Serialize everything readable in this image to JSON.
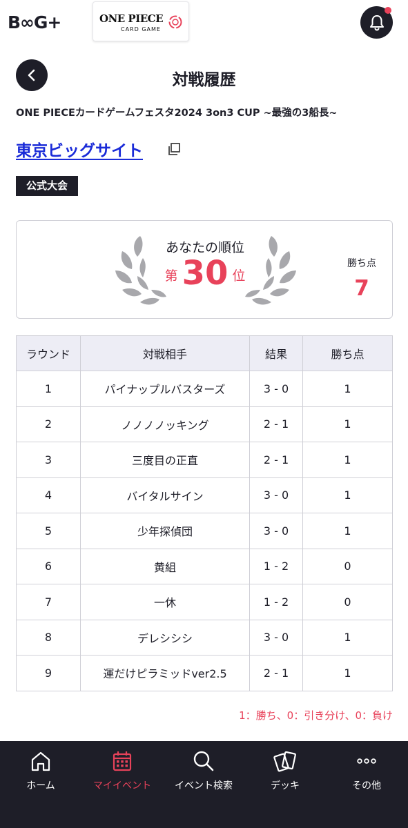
{
  "header": {
    "brand_logo": "B∞G+",
    "game_logo_title": "ONE PIECE",
    "game_logo_subtitle": "CARD GAME",
    "notification_icon": "bell-icon",
    "has_unread": true
  },
  "page": {
    "back_icon": "chevron-left-icon",
    "title": "対戦履歴",
    "event_name": "ONE PIECEカードゲームフェスタ2024 3on3 CUP ~最強の3船長~",
    "venue": "東京ビッグサイト",
    "venue_link_icon": "external-link-icon",
    "badge": "公式大会"
  },
  "rank": {
    "label": "あなたの順位",
    "prefix": "第",
    "number": "30",
    "suffix": "位",
    "points_label": "勝ち点",
    "points_value": "7"
  },
  "table": {
    "headers": [
      "ラウンド",
      "対戦相手",
      "結果",
      "勝ち点"
    ],
    "rows": [
      {
        "round": "1",
        "opponent": "パイナップルバスターズ",
        "result": "3 - 0",
        "points": "1"
      },
      {
        "round": "2",
        "opponent": "ノノノノッキング",
        "result": "2 - 1",
        "points": "1"
      },
      {
        "round": "3",
        "opponent": "三度目の正直",
        "result": "2 - 1",
        "points": "1"
      },
      {
        "round": "4",
        "opponent": "バイタルサイン",
        "result": "3 - 0",
        "points": "1"
      },
      {
        "round": "5",
        "opponent": "少年探偵団",
        "result": "3 - 0",
        "points": "1"
      },
      {
        "round": "6",
        "opponent": "黄組",
        "result": "1 - 2",
        "points": "0"
      },
      {
        "round": "7",
        "opponent": "一休",
        "result": "1 - 2",
        "points": "0"
      },
      {
        "round": "8",
        "opponent": "デレシシシ",
        "result": "3 - 0",
        "points": "1"
      },
      {
        "round": "9",
        "opponent": "運だけピラミッドver2.5",
        "result": "2 - 1",
        "points": "1"
      }
    ]
  },
  "legend": "1：勝ち、0：引き分け、0：負け",
  "nav": {
    "items": [
      {
        "label": "ホーム",
        "icon": "home-icon",
        "active": false
      },
      {
        "label": "マイイベント",
        "icon": "calendar-icon",
        "active": true
      },
      {
        "label": "イベント検索",
        "icon": "search-icon",
        "active": false
      },
      {
        "label": "デッキ",
        "icon": "cards-icon",
        "active": false
      },
      {
        "label": "その他",
        "icon": "more-icon",
        "active": false
      }
    ]
  },
  "colors": {
    "accent": "#e8425a",
    "dark": "#1e1e28",
    "link": "#1a2bd8",
    "table_header_bg": "#ededf5"
  }
}
